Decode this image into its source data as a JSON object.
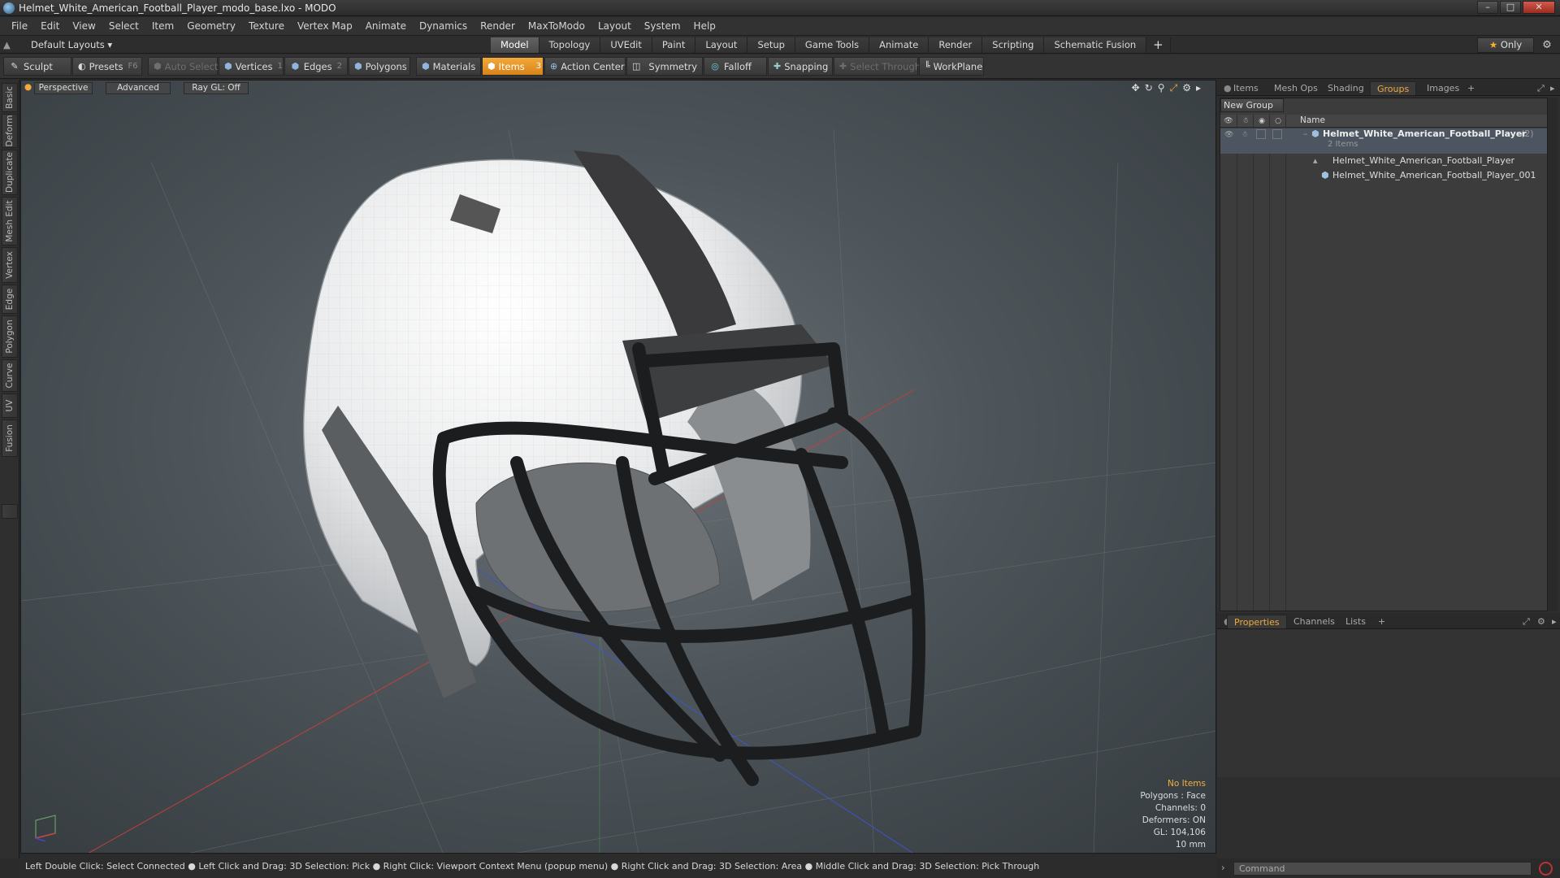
{
  "window": {
    "title": "Helmet_White_American_Football_Player_modo_base.lxo - MODO",
    "min": "–",
    "max": "□",
    "close": "✕"
  },
  "menu": [
    "File",
    "Edit",
    "View",
    "Select",
    "Item",
    "Geometry",
    "Texture",
    "Vertex Map",
    "Animate",
    "Dynamics",
    "Render",
    "MaxToModo",
    "Layout",
    "System",
    "Help"
  ],
  "layouts": {
    "dropdown": "Default Layouts ▾",
    "tabs": [
      "Model",
      "Topology",
      "UVEdit",
      "Paint",
      "Layout",
      "Setup",
      "Game Tools",
      "Animate",
      "Render",
      "Scripting",
      "Schematic Fusion"
    ],
    "active": "Model",
    "add": "+",
    "only": "Only"
  },
  "toolbar": {
    "sculpt": "Sculpt",
    "presets": "Presets",
    "presets_key": "F6",
    "auto_select": "Auto Select",
    "vertices": "Vertices",
    "vertices_count": "1",
    "edges": "Edges",
    "edges_count": "2",
    "polygons": "Polygons",
    "materials": "Materials",
    "items": "Items",
    "items_count": "3",
    "action_center": "Action Center",
    "symmetry": "Symmetry",
    "falloff": "Falloff",
    "snapping": "Snapping",
    "select_through": "Select Through",
    "workplane": "WorkPlane"
  },
  "left_tabs": [
    "Basic",
    "Deform",
    "Duplicate",
    "Mesh Edit",
    "Vertex",
    "Edge",
    "Polygon",
    "Curve",
    "UV",
    "Fusion"
  ],
  "viewport": {
    "view": "Perspective",
    "style": "Advanced",
    "raygl": "Ray GL: Off",
    "info": {
      "items": "No Items",
      "polygons": "Polygons : Face",
      "channels": "Channels: 0",
      "deformers": "Deformers: ON",
      "gl": "GL: 104,106",
      "scale": "10 mm"
    }
  },
  "status": "Left Double Click: Select Connected ● Left Click and Drag: 3D Selection: Pick ● Right Click: Viewport Context Menu (popup menu) ● Right Click and Drag: 3D Selection: Area ● Middle Click and Drag: 3D Selection: Pick Through",
  "right_panel": {
    "tabs": [
      "Items",
      "Mesh Ops",
      "Shading",
      "Groups",
      "Images"
    ],
    "active_tab": "Groups",
    "add": "+",
    "new_group": "New Group",
    "col_name": "Name",
    "group": {
      "name": "Helmet_White_American_Football_Player",
      "count": "(2)",
      "sub": "2 Items",
      "children": [
        "Helmet_White_American_Football_Player",
        "Helmet_White_American_Football_Player_001"
      ]
    }
  },
  "bottom_panel": {
    "tabs": [
      "Properties",
      "Channels",
      "Lists"
    ],
    "active_tab": "Properties",
    "add": "+"
  },
  "command": {
    "placeholder": "Command"
  },
  "colors": {
    "accent": "#f2a93a",
    "info_highlight": "#f0b03e"
  }
}
